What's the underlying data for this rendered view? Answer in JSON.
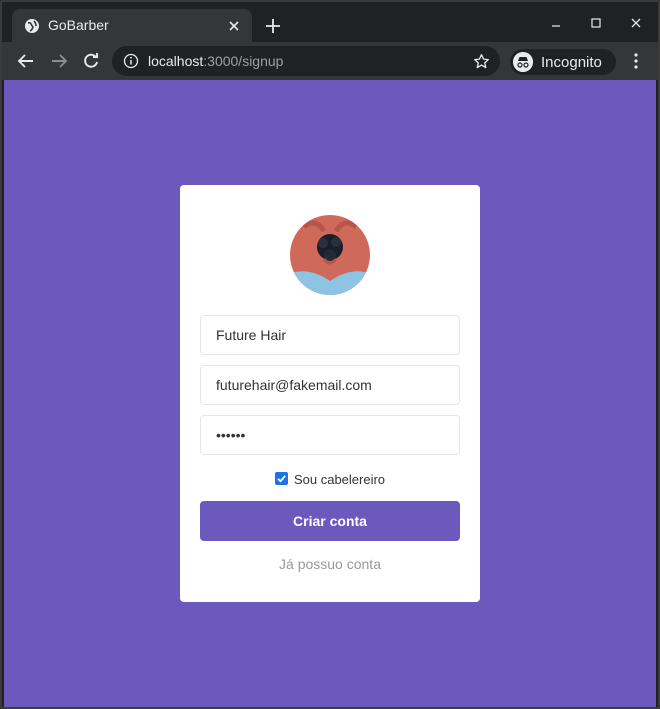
{
  "browser": {
    "tab_title": "GoBarber",
    "url_host": "localhost",
    "url_rest": ":3000/signup",
    "incognito_label": "Incognito"
  },
  "form": {
    "name_value": "Future Hair",
    "email_value": "futurehair@fakemail.com",
    "password_value": "••••••",
    "checkbox_label": "Sou cabelereiro",
    "checkbox_checked": true,
    "submit_label": "Criar conta",
    "login_link": "Já possuo conta"
  },
  "colors": {
    "background": "#6c59be",
    "primary_button": "#6c59be",
    "card": "#ffffff"
  }
}
